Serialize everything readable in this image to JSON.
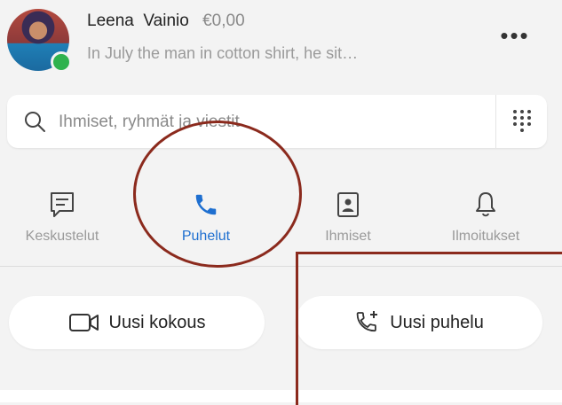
{
  "profile": {
    "first_name": "Leena",
    "last_name": "Vainio",
    "balance": "€0,00",
    "status_message": "In July the man in cotton shirt, he sit…",
    "presence_color": "#2fb24e"
  },
  "search": {
    "placeholder": "Ihmiset, ryhmät ja viestit"
  },
  "tabs": [
    {
      "label": "Keskustelut",
      "icon": "chat-icon",
      "active": false
    },
    {
      "label": "Puhelut",
      "icon": "phone-icon",
      "active": true
    },
    {
      "label": "Ihmiset",
      "icon": "contacts-icon",
      "active": false
    },
    {
      "label": "Ilmoitukset",
      "icon": "bell-icon",
      "active": false
    }
  ],
  "actions": {
    "new_meeting_label": "Uusi kokous",
    "new_call_label": "Uusi puhelu"
  },
  "colors": {
    "accent": "#1e6fd0",
    "annotation": "#8b2a1d",
    "background": "#f3f3f3"
  }
}
